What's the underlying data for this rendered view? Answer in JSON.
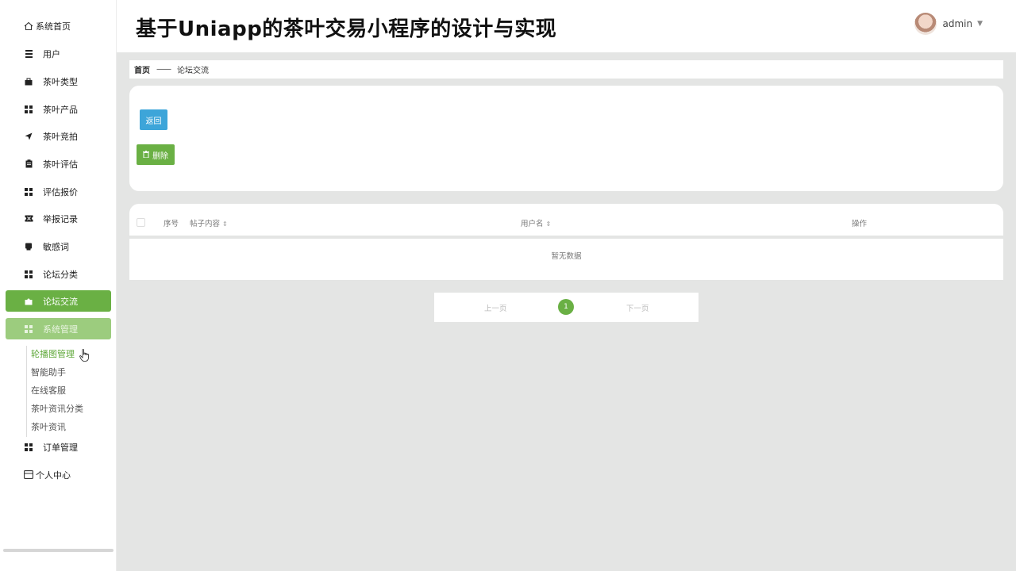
{
  "sidebar": {
    "items": [
      {
        "label": "系统首页",
        "icon": "home-icon"
      },
      {
        "label": "用户",
        "icon": "list-icon"
      },
      {
        "label": "茶叶类型",
        "icon": "briefcase-icon"
      },
      {
        "label": "茶叶产品",
        "icon": "grid-icon"
      },
      {
        "label": "茶叶竞拍",
        "icon": "send-icon"
      },
      {
        "label": "茶叶评估",
        "icon": "clipboard-icon"
      },
      {
        "label": "评估报价",
        "icon": "grid-icon"
      },
      {
        "label": "举报记录",
        "icon": "ticket-icon"
      },
      {
        "label": "敏感词",
        "icon": "print-icon"
      },
      {
        "label": "论坛分类",
        "icon": "grid-icon"
      },
      {
        "label": "论坛交流",
        "icon": "puzzle-icon"
      },
      {
        "label": "系统管理",
        "icon": "grid-icon"
      },
      {
        "label": "订单管理",
        "icon": "grid-icon"
      },
      {
        "label": "个人中心",
        "icon": "calendar-icon"
      }
    ],
    "submenu": [
      "轮播图管理",
      "智能助手",
      "在线客服",
      "茶叶资讯分类",
      "茶叶资讯"
    ]
  },
  "header": {
    "title": "基于Uniapp的茶叶交易小程序的设计与实现",
    "username": "admin",
    "caret": "▼"
  },
  "breadcrumb": {
    "home": "首页",
    "separator": "——",
    "current": "论坛交流"
  },
  "actions": {
    "back_label": "返回",
    "delete_label": "删除"
  },
  "table": {
    "columns": [
      "序号",
      "帖子内容",
      "用户名",
      "操作"
    ],
    "empty_text": "暂无数据"
  },
  "pagination": {
    "prev_label": "上一页",
    "current_page": "1",
    "next_label": "下一页"
  },
  "colors": {
    "accent_green": "#6ab044",
    "back_button_blue": "#3da5d9"
  }
}
